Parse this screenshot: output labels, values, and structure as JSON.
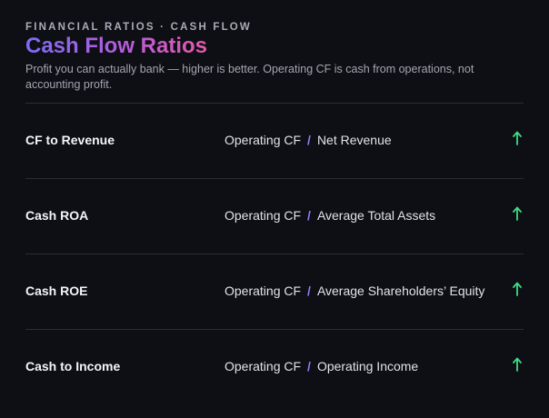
{
  "header": {
    "eyebrow": "FINANCIAL RATIOS · CASH FLOW",
    "title": "Cash Flow Ratios",
    "subtitle": "Profit you can actually bank — higher is better. Operating CF is cash from operations, not accounting profit."
  },
  "colors": {
    "background": "#0e0f14",
    "title_gradient_start": "#7c6cf6",
    "title_gradient_end": "#e45aa8",
    "slash": "#8b7cf8",
    "up_arrow": "#3ddc84",
    "divider": "#2a2c36"
  },
  "ratios": [
    {
      "name": "CF to Revenue",
      "numerator": "Operating CF",
      "separator": "/",
      "denominator": "Net Revenue",
      "trend_icon": "arrow-up-icon"
    },
    {
      "name": "Cash ROA",
      "numerator": "Operating CF",
      "separator": "/",
      "denominator": "Average Total Assets",
      "trend_icon": "arrow-up-icon"
    },
    {
      "name": "Cash ROE",
      "numerator": "Operating CF",
      "separator": "/",
      "denominator": "Average Shareholders’ Equity",
      "trend_icon": "arrow-up-icon"
    },
    {
      "name": "Cash to Income",
      "numerator": "Operating CF",
      "separator": "/",
      "denominator": "Operating Income",
      "trend_icon": "arrow-up-icon"
    }
  ]
}
